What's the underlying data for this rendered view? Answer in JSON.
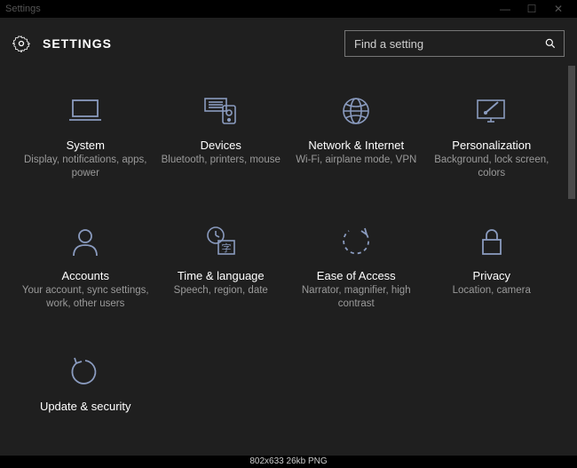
{
  "window": {
    "title": "Settings"
  },
  "header": {
    "title": "SETTINGS"
  },
  "search": {
    "placeholder": "Find a setting"
  },
  "tiles": [
    {
      "title": "System",
      "desc": "Display, notifications, apps, power"
    },
    {
      "title": "Devices",
      "desc": "Bluetooth, printers, mouse"
    },
    {
      "title": "Network & Internet",
      "desc": "Wi-Fi, airplane mode, VPN"
    },
    {
      "title": "Personalization",
      "desc": "Background, lock screen, colors"
    },
    {
      "title": "Accounts",
      "desc": "Your account, sync settings, work, other users"
    },
    {
      "title": "Time & language",
      "desc": "Speech, region, date"
    },
    {
      "title": "Ease of Access",
      "desc": "Narrator, magnifier, high contrast"
    },
    {
      "title": "Privacy",
      "desc": "Location, camera"
    },
    {
      "title": "Update & security",
      "desc": ""
    }
  ],
  "footer": {
    "meta": "802x633 26kb PNG"
  }
}
